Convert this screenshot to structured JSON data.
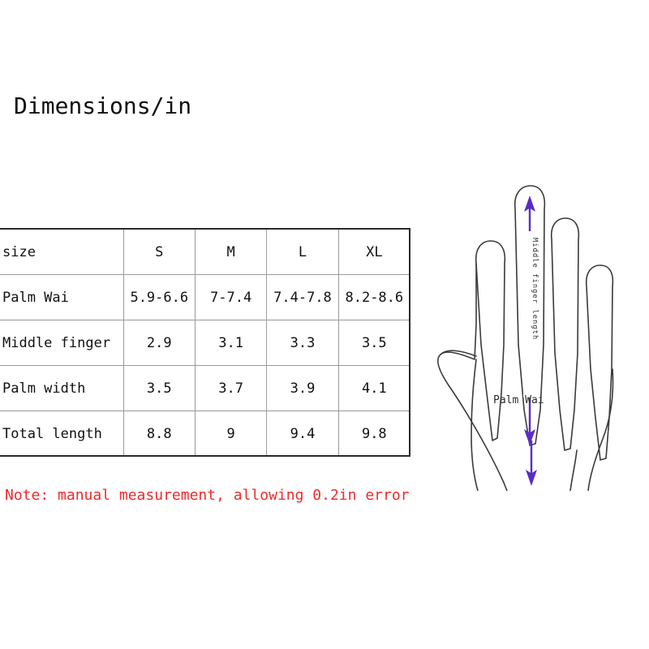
{
  "page": {
    "title": "Dimensions/in",
    "background_color": "#ffffff"
  },
  "table": {
    "columns": [
      "size",
      "S",
      "M",
      "L",
      "XL"
    ],
    "rows": [
      {
        "label": "Palm Wai",
        "values": [
          "5.9-6.6",
          "7-7.4",
          "7.4-7.8",
          "8.2-8.6"
        ]
      },
      {
        "label": "Middle finger",
        "values": [
          "2.9",
          "3.1",
          "3.3",
          "3.5"
        ]
      },
      {
        "label": "Palm width",
        "values": [
          "3.5",
          "3.7",
          "3.9",
          "4.1"
        ]
      },
      {
        "label": "Total length",
        "values": [
          "8.8",
          "9",
          "9.4",
          "9.8"
        ]
      }
    ],
    "border_color": "#9a9a9a",
    "outer_border_color": "#2b2b2b"
  },
  "note": {
    "text": "Note: manual measurement, allowing 0.2in error",
    "color": "#ef2a2a"
  },
  "diagram": {
    "middle_finger_label": "Middle finger  length",
    "palm_label": "Palm Wai",
    "hand_outline_color": "#3a3a3a",
    "ruler_color": "#f03cc8",
    "ruler_tick_color": "#6b1f6b",
    "arrow_blue": "#3311cc",
    "arrow_purple": "#5b2bc8"
  }
}
